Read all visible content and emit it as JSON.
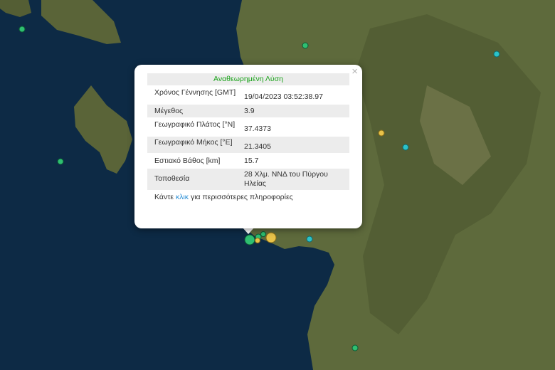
{
  "popup": {
    "title": "Αναθεωρημένη Λύση",
    "close_symbol": "×",
    "rows": [
      {
        "label": "Χρόνος Γέννησης [GMT]",
        "value": "19/04/2023 03:52:38.97"
      },
      {
        "label": "Μέγεθος",
        "value": "3.9"
      },
      {
        "label": "Γεωγραφικό Πλάτος [°N]",
        "value": "37.4373"
      },
      {
        "label": "Γεωγραφικό Μήκος [°E]",
        "value": "21.3405"
      },
      {
        "label": "Εστιακό Βάθος [km]",
        "value": "15.7"
      },
      {
        "label": "Τοποθεσία",
        "value": "28 Χλμ. ΝΝΔ του Πύργου Ηλείας"
      }
    ],
    "more_prefix": "Κάντε",
    "more_link": "κλικ",
    "more_suffix": "για περισσότερες πληροφορίες"
  },
  "colors": {
    "sea": "#0d2a45",
    "land": "#5e6a3c",
    "title_green": "#1aa31a",
    "link_blue": "#2a8fd6",
    "marker_green": "#2fbf71",
    "marker_cyan": "#2bc2c9",
    "marker_yellow": "#e8c24a"
  }
}
